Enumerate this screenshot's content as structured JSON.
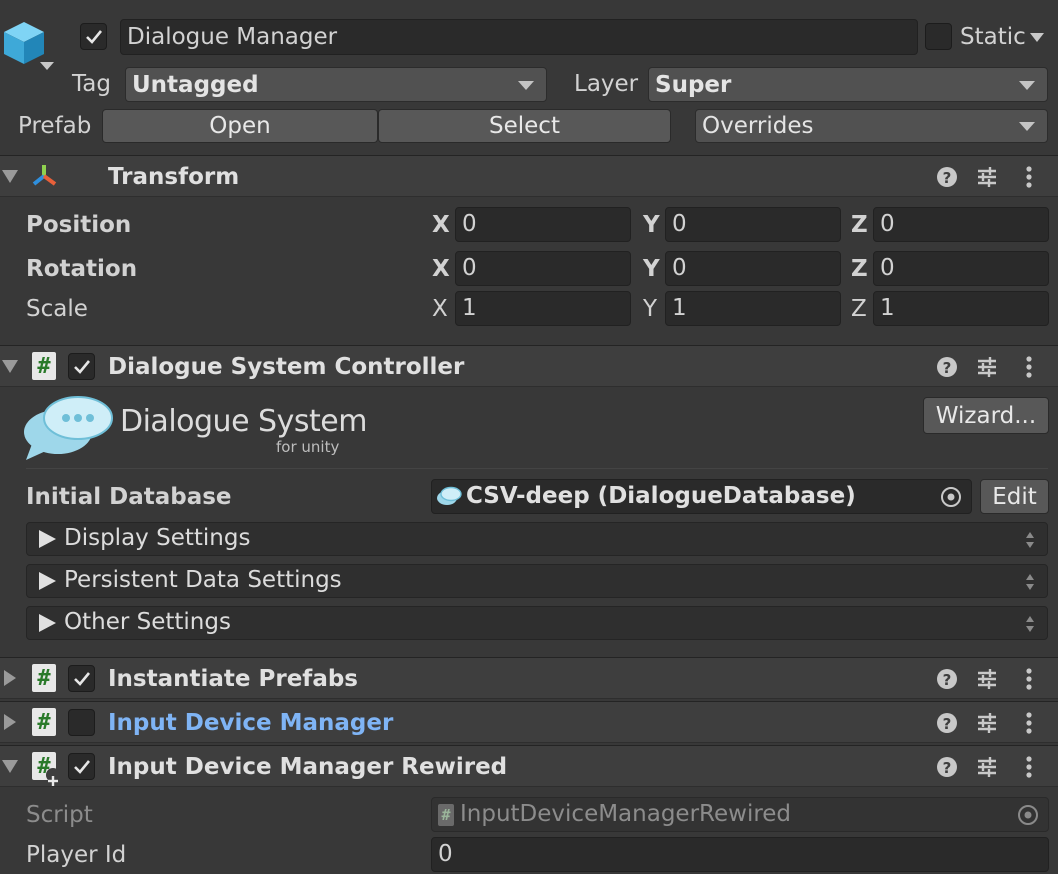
{
  "object": {
    "name": "Dialogue Manager",
    "static_label": "Static",
    "tag_label": "Tag",
    "tag_value": "Untagged",
    "layer_label": "Layer",
    "layer_value": "Super",
    "prefab_label": "Prefab",
    "open_label": "Open",
    "select_label": "Select",
    "overrides_label": "Overrides"
  },
  "transform": {
    "title": "Transform",
    "rows": [
      {
        "label": "Position",
        "x": "0",
        "y": "0",
        "z": "0"
      },
      {
        "label": "Rotation",
        "x": "0",
        "y": "0",
        "z": "0"
      },
      {
        "label": "Scale",
        "x": "1",
        "y": "1",
        "z": "1"
      }
    ],
    "axis": {
      "x": "X",
      "y": "Y",
      "z": "Z"
    }
  },
  "dsc": {
    "title": "Dialogue System Controller",
    "logo_main": "Dialogue System",
    "logo_sub": "for unity",
    "wizard_label": "Wizard...",
    "initial_db_label": "Initial Database",
    "initial_db_value": "CSV-deep (DialogueDatabase)",
    "edit_label": "Edit",
    "sections": [
      "Display Settings",
      "Persistent Data Settings",
      "Other Settings"
    ]
  },
  "components": {
    "instantiate_prefabs": "Instantiate Prefabs",
    "input_device_manager": "Input Device Manager",
    "input_device_manager_rewired": "Input Device Manager Rewired"
  },
  "rewired": {
    "script_label": "Script",
    "script_value": "InputDeviceManagerRewired",
    "player_id_label": "Player Id",
    "player_id_value": "0"
  },
  "colors": {
    "background": "#383838",
    "header": "#3e3e3e",
    "field": "#2a2a2a",
    "link_blue": "#7fb4f5"
  }
}
